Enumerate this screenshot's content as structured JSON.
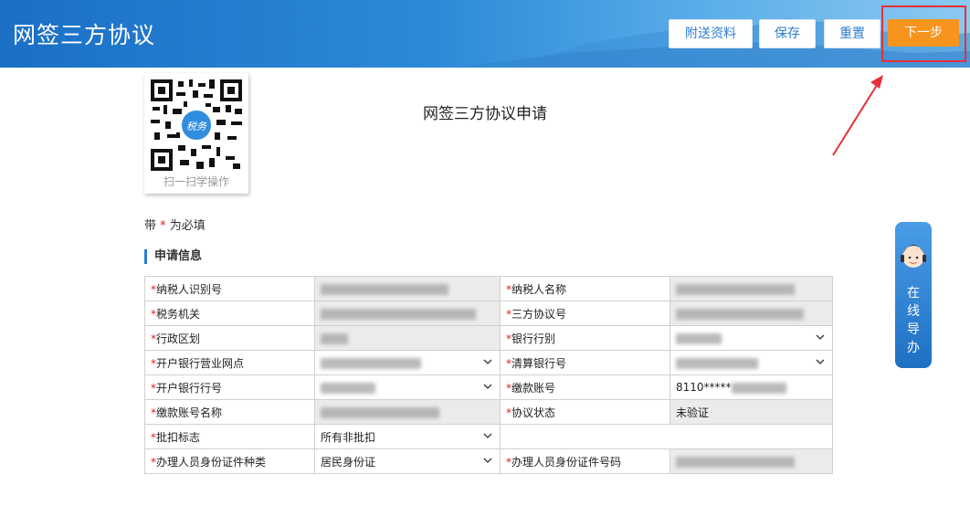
{
  "header": {
    "title": "网签三方协议",
    "buttons": {
      "attach": "附送资料",
      "save": "保存",
      "reset": "重置",
      "next": "下一步"
    }
  },
  "qr": {
    "caption": "扫一扫学操作",
    "badge": "税务"
  },
  "form": {
    "title": "网签三方协议申请",
    "required_prefix": "带",
    "required_star": "*",
    "required_suffix": "为必填",
    "section_title": "申请信息",
    "rows": [
      {
        "l1": "纳税人识别号",
        "v1": "",
        "l2": "纳税人名称",
        "v2": ""
      },
      {
        "l1": "税务机关",
        "v1": "",
        "l2": "三方协议号",
        "v2": ""
      },
      {
        "l1": "行政区划",
        "v1": "",
        "l2": "银行行别",
        "v2": ""
      },
      {
        "l1": "开户银行营业网点",
        "v1": "",
        "l2": "清算银行号",
        "v2": ""
      },
      {
        "l1": "开户银行行号",
        "v1": "",
        "l2": "缴款账号",
        "v2": "8110*****"
      },
      {
        "l1": "缴款账号名称",
        "v1": "",
        "l2": "协议状态",
        "v2": "未验证"
      },
      {
        "l1": "批扣标志",
        "v1": "所有非批扣",
        "l2": "",
        "v2": ""
      },
      {
        "l1": "办理人员身份证件种类",
        "v1": "居民身份证",
        "l2": "办理人员身份证件号码",
        "v2": ""
      }
    ]
  },
  "online": {
    "label": "在线导办"
  },
  "colors": {
    "accent": "#2a7dd0",
    "next_button": "#f7941d",
    "highlight": "#e5303a"
  }
}
